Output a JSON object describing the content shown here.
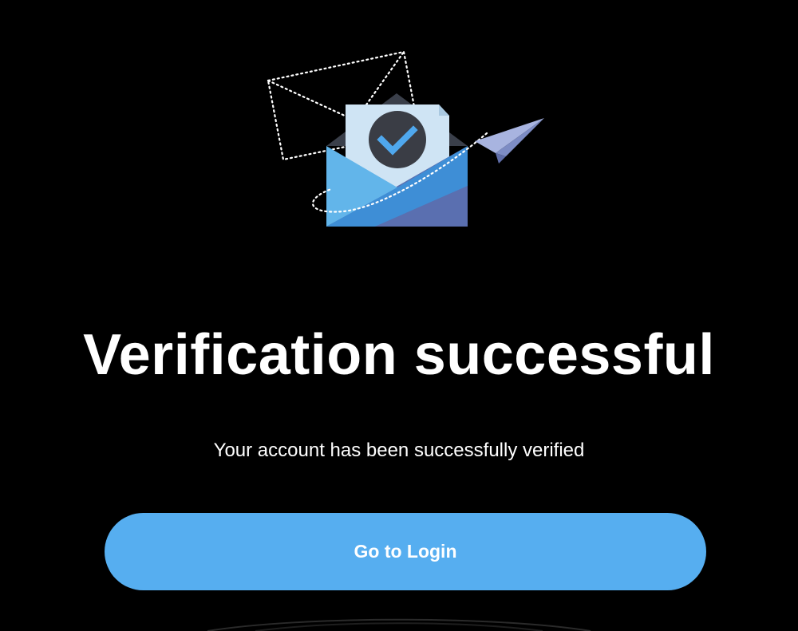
{
  "illustration": {
    "icon": "email-verified-icon",
    "colors": {
      "envelope_front": "#3d8fd8",
      "envelope_left": "#62b5ea",
      "envelope_right": "#5a6fb0",
      "envelope_back": "#3a3f4a",
      "letter": "#cfe4f4",
      "check_circle": "#3a3d45",
      "check_mark": "#4fa8ee",
      "paper_plane": "#a8b4e0",
      "dotted_lines": "#ffffff"
    }
  },
  "title": "Verification successful",
  "subtitle": "Your account has been successfully verified",
  "button": {
    "label": "Go to Login",
    "color": "#56aef0"
  }
}
